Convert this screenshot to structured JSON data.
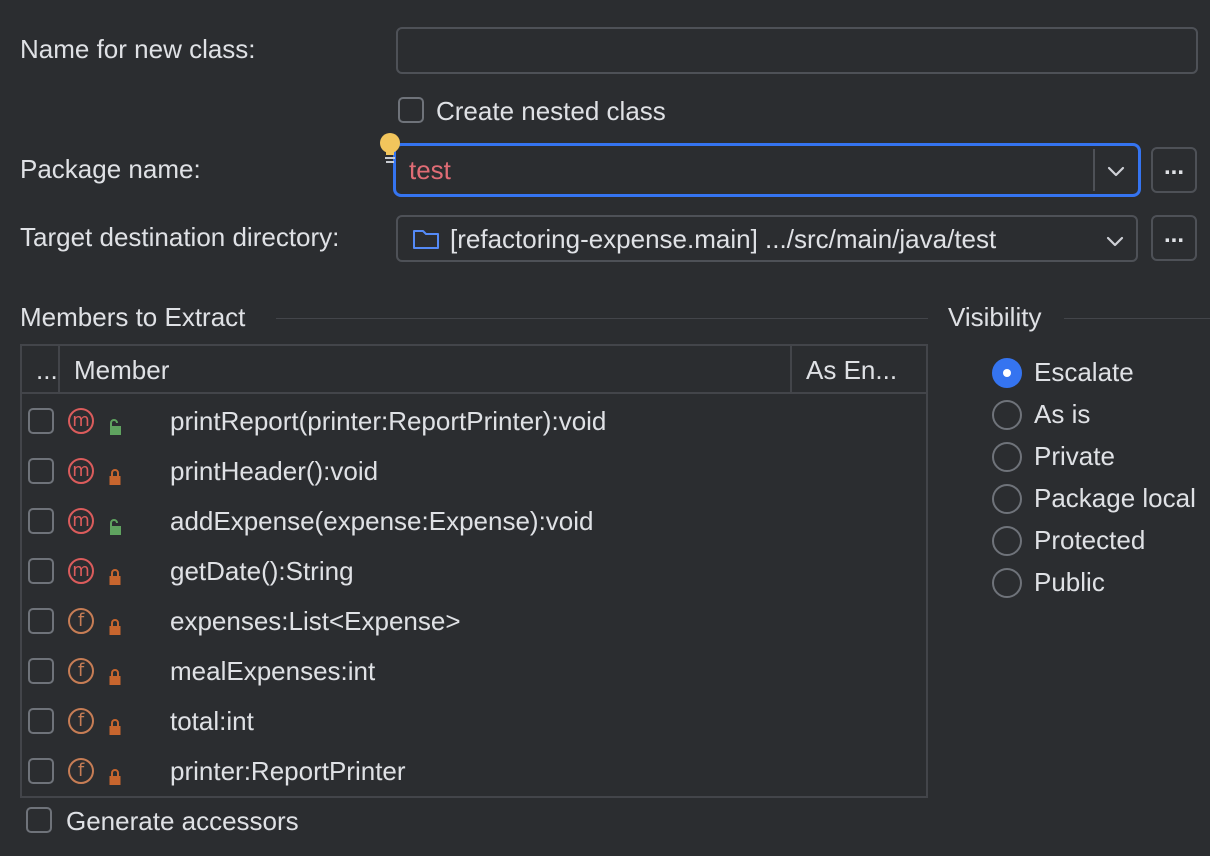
{
  "form": {
    "name_label": "Name for new class:",
    "name_value": "",
    "nested_label": "Create nested class",
    "package_label": "Package name:",
    "package_value": "test",
    "package_browse": "...",
    "target_label": "Target destination directory:",
    "target_value": "[refactoring-expense.main] .../src/main/java/test",
    "target_browse": "..."
  },
  "members": {
    "title": "Members to Extract",
    "columns": {
      "check": "...",
      "member": "Member",
      "as_enum": "As En..."
    },
    "rows": [
      {
        "kind": "m",
        "access": "public",
        "text": "printReport(printer:ReportPrinter):void"
      },
      {
        "kind": "m",
        "access": "private",
        "text": "printHeader():void"
      },
      {
        "kind": "m",
        "access": "public",
        "text": "addExpense(expense:Expense):void"
      },
      {
        "kind": "m",
        "access": "private",
        "text": "getDate():String"
      },
      {
        "kind": "f",
        "access": "private",
        "text": "expenses:List<Expense>"
      },
      {
        "kind": "f",
        "access": "private",
        "text": "mealExpenses:int"
      },
      {
        "kind": "f",
        "access": "private",
        "text": "total:int"
      },
      {
        "kind": "f",
        "access": "private",
        "text": "printer:ReportPrinter"
      }
    ],
    "generate_accessors": "Generate accessors"
  },
  "visibility": {
    "title": "Visibility",
    "selected": "Escalate",
    "options": [
      "Escalate",
      "As is",
      "Private",
      "Package local",
      "Protected",
      "Public"
    ]
  },
  "colors": {
    "accent": "#3574f0",
    "error_text": "#e06c75",
    "method_icon": "#db5c5c",
    "field_icon": "#c77d55",
    "lock_private": "#c7652e",
    "lock_public": "#5fa35f",
    "hint_bulb": "#f2c55c"
  }
}
